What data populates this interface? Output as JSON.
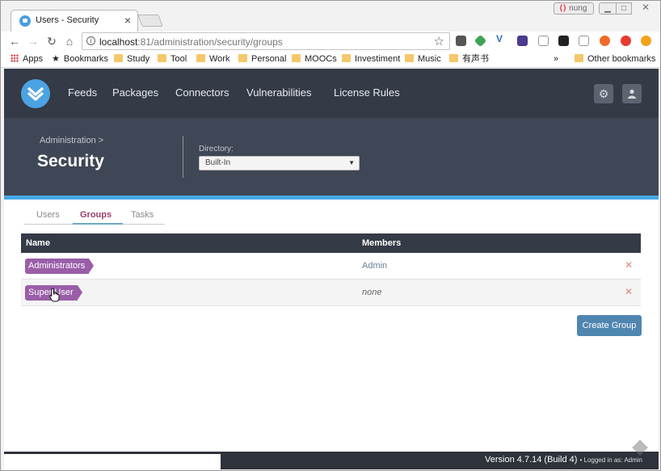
{
  "browser": {
    "tab_title": "Users - Security",
    "user_chip": "nung",
    "url_host": "localhost",
    "url_rest": ":81/administration/security/groups",
    "bookmarks": [
      "Apps",
      "Bookmarks",
      "Study",
      "Tool",
      "Work",
      "Personal",
      "MOOCs",
      "Investiment",
      "Music",
      "有声书"
    ],
    "more": "»",
    "other_bookmarks": "Other bookmarks"
  },
  "nav": {
    "links": [
      "Feeds",
      "Packages",
      "Connectors",
      "Vulnerabilities",
      "License Rules"
    ]
  },
  "header": {
    "breadcrumb": "Administration >",
    "title": "Security",
    "directory_label": "Directory:",
    "directory_value": "Built-In"
  },
  "tabs": [
    "Users",
    "Groups",
    "Tasks"
  ],
  "active_tab": "Groups",
  "table": {
    "headers": [
      "Name",
      "Members"
    ],
    "rows": [
      {
        "name": "Administrators",
        "members": "Admin"
      },
      {
        "name": "Super User",
        "members": "none"
      }
    ]
  },
  "create_button": "Create Group",
  "footer": {
    "version": "Version 4.7.14 (Build 4)",
    "logged_in": "• Logged in as: Admin"
  },
  "colors": {
    "nav_bg": "#343a46",
    "header_bg": "#3f4655",
    "accent_blue": "#47a8e5",
    "pill_purple": "#9a5ea8",
    "button_blue": "#4f86b0"
  }
}
